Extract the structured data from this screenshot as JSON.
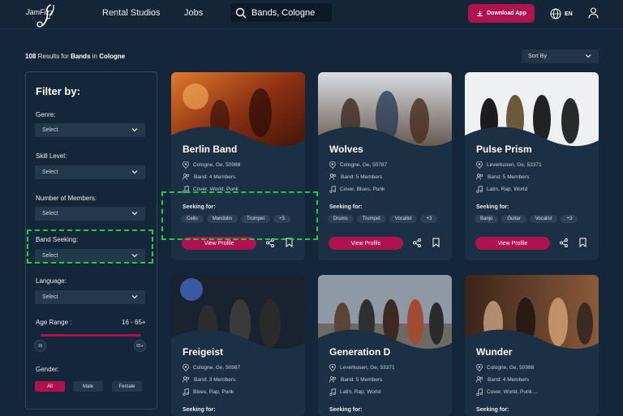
{
  "header": {
    "logo_text": "JamFizz",
    "nav": [
      "Rental Studios",
      "Jobs"
    ],
    "search_value": "Bands, Cologne",
    "download_label": "Download App",
    "lang": "EN"
  },
  "results": {
    "count": "108",
    "text1": "Results for",
    "what": "Bands",
    "text2": "in",
    "where": "Cologne"
  },
  "sort_label": "Sort By",
  "filter": {
    "title": "Filter by:",
    "genre_label": "Genre:",
    "skill_label": "Skill Level:",
    "members_label": "Number of Members:",
    "seeking_label": "Band Seeking:",
    "language_label": "Language:",
    "select_placeholder": "Select",
    "age_label": "Age Range :",
    "age_value": "16 - 65+",
    "age_min": "16",
    "age_max": "65+",
    "gender_label": "Gender:",
    "genders": [
      "All",
      "Male",
      "Female"
    ]
  },
  "cards": [
    {
      "name": "Berlin Band",
      "location": "Cologne, Ge, 50988",
      "members": "Band: 4 Members",
      "genres": "Cover, World, Punk",
      "seeking_label": "Seeking for:",
      "tags": [
        "Cello",
        "Mandolin",
        "Trumpet",
        "+3"
      ],
      "cta": "View Profile"
    },
    {
      "name": "Wolves",
      "location": "Cologne, Ge, 50787",
      "members": "Band: 5 Members",
      "genres": "Cover, Blues, Punk",
      "seeking_label": "Seeking for:",
      "tags": [
        "Drums",
        "Trumpet",
        "Vocalist",
        "+3"
      ],
      "cta": "View Profile"
    },
    {
      "name": "Pulse Prism",
      "location": "Leverkusen, Ge, 53371",
      "members": "Band: 5 Members",
      "genres": "Latin, Rap, World",
      "seeking_label": "Seeking for:",
      "tags": [
        "Banjo",
        "Guitar",
        "Vocalist",
        "+3"
      ],
      "cta": "View Profile"
    },
    {
      "name": "Freigeist",
      "location": "Cologne, Ge, 50987",
      "members": "Band: 3 Members",
      "genres": "Blues, Rap, Punk",
      "seeking_label": "Seeking for:",
      "tags": [],
      "cta": ""
    },
    {
      "name": "Generation D",
      "location": "Leverkusen, Ge, 53371",
      "members": "Band: 5 Members",
      "genres": "Latin, Rap, World",
      "seeking_label": "Seeking for:",
      "tags": [],
      "cta": ""
    },
    {
      "name": "Wunder",
      "location": "Cologne, Ge, 50988",
      "members": "Band: 4 Members",
      "genres": "Cover, World, Punk ...",
      "seeking_label": "Seeking for:",
      "tags": [],
      "cta": ""
    }
  ],
  "colors": {
    "accent": "#b0124f",
    "background": "#14263a",
    "card": "#1b3044",
    "highlight": "#16d13a"
  }
}
